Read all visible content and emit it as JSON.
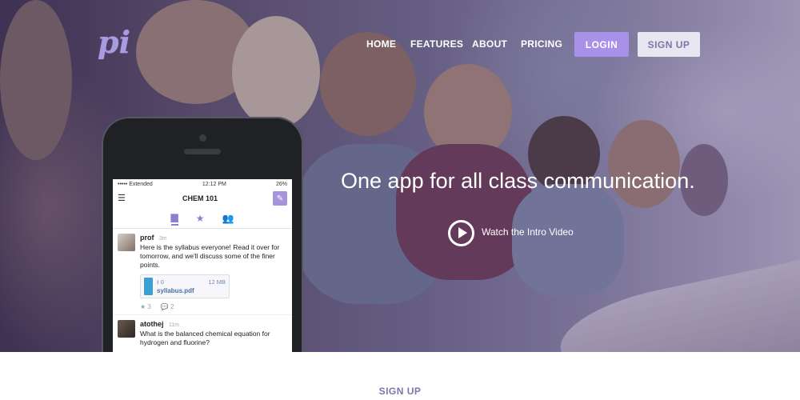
{
  "brand": {
    "logo_text": "pi",
    "accent": "#a990e8"
  },
  "nav": {
    "items": [
      "HOME",
      "FEATURES",
      "ABOUT",
      "PRICING"
    ],
    "login_label": "LOGIN",
    "signup_label": "SIGN UP"
  },
  "hero": {
    "headline": "One app for all class communication.",
    "video_label": "Watch the Intro Video"
  },
  "phone": {
    "status": {
      "carrier": "••••• Extended",
      "time": "12:12 PM",
      "battery": "26%"
    },
    "course_title": "CHEM 101",
    "tabs": [
      "chat-icon",
      "star-icon",
      "people-icon"
    ],
    "posts": [
      {
        "author": "prof",
        "time": "3m",
        "text": "Here is the syllabus everyone!  Read it over for tomorrow, and we'll discuss some of the finer points.",
        "file": {
          "downloads": "0",
          "size": "12 MB",
          "name": "syllabus.pdf"
        },
        "stars": "3",
        "comments": "2"
      },
      {
        "author": "atothej",
        "time": "11m",
        "text": "What is the balanced chemical equation for hydrogen and fluorine?"
      }
    ]
  },
  "footer": {
    "signup_heading": "SIGN UP"
  }
}
